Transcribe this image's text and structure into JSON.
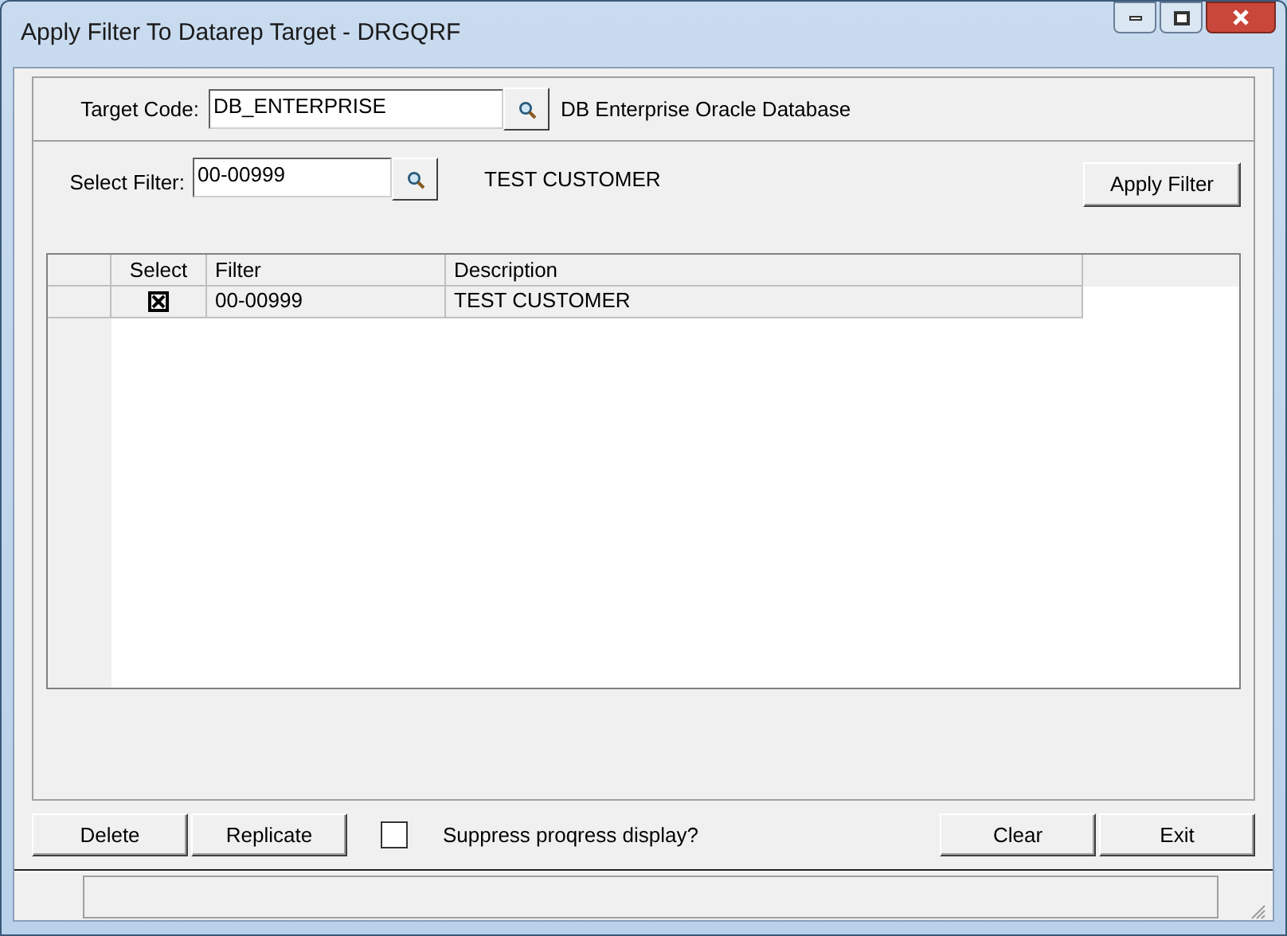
{
  "window": {
    "title": "Apply Filter To Datarep Target - DRGQRF"
  },
  "target": {
    "label": "Target Code:",
    "value": "DB_ENTERPRISE",
    "description": "DB Enterprise Oracle Database"
  },
  "filter": {
    "label": "Select Filter:",
    "value": "00-00999",
    "description": "TEST CUSTOMER",
    "apply_button": "Apply Filter"
  },
  "grid": {
    "columns": [
      "Select",
      "Filter",
      "Description"
    ],
    "rows": [
      {
        "checked": true,
        "filter": "00-00999",
        "description": "TEST CUSTOMER"
      }
    ]
  },
  "buttons_left": [
    "Delete",
    "Replicate"
  ],
  "suppress": {
    "label": "Suppress proqress display?",
    "checked": false
  },
  "buttons_right": [
    "Clear",
    "Exit"
  ]
}
